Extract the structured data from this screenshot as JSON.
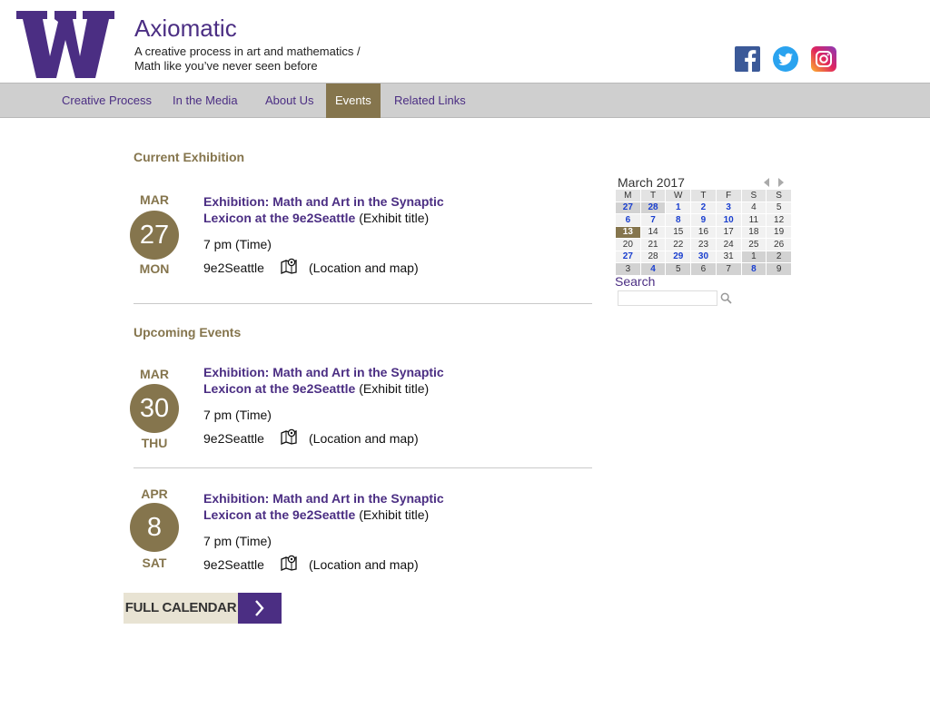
{
  "header": {
    "site_title": "Axiomatic",
    "tagline_line1": "A creative process in art and mathematics /",
    "tagline_line2": "Math like you’ve never seen before",
    "logo_icon": "uw-w-logo",
    "social": [
      "facebook-icon",
      "twitter-icon",
      "instagram-icon"
    ]
  },
  "nav": {
    "items": [
      {
        "label": "Creative Process"
      },
      {
        "label": "In the Media"
      },
      {
        "label": "About Us"
      },
      {
        "label": "Events",
        "active": true
      },
      {
        "label": "Related Links"
      }
    ]
  },
  "current": {
    "heading": "Current Exhibition",
    "event": {
      "month": "MAR",
      "day": "27",
      "dow": "MON",
      "title": "Exhibition: Math and Art in the Synaptic Lexicon at the 9e2Seattle",
      "title_note": "(Exhibit title)",
      "time": "7 pm (Time)",
      "location": "9e2Seattle",
      "location_note": "(Location and map)"
    }
  },
  "upcoming": {
    "heading": "Upcoming Events",
    "events": [
      {
        "month": "MAR",
        "day": "30",
        "dow": "THU",
        "title": "Exhibition: Math and Art in the Synaptic Lexicon at the 9e2Seattle",
        "title_note": "(Exhibit title)",
        "time": "7 pm (Time)",
        "location": "9e2Seattle",
        "location_note": "(Location and map)"
      },
      {
        "month": "APR",
        "day": "8",
        "dow": "SAT",
        "title": "Exhibition: Math and Art in the Synaptic Lexicon at the 9e2Seattle",
        "title_note": "(Exhibit title)",
        "time": "7 pm (Time)",
        "location": "9e2Seattle",
        "location_note": "(Location and map)"
      }
    ]
  },
  "full_calendar_label": "FULL CALENDAR",
  "calendar": {
    "title": "March 2017",
    "weekdays": [
      "M",
      "T",
      "W",
      "T",
      "F",
      "S",
      "S"
    ],
    "weeks": [
      [
        {
          "d": "27",
          "o": true,
          "l": true
        },
        {
          "d": "28",
          "o": true,
          "l": true
        },
        {
          "d": "1",
          "l": true
        },
        {
          "d": "2",
          "l": true
        },
        {
          "d": "3",
          "l": true
        },
        {
          "d": "4"
        },
        {
          "d": "5"
        }
      ],
      [
        {
          "d": "6",
          "l": true
        },
        {
          "d": "7",
          "l": true
        },
        {
          "d": "8",
          "l": true
        },
        {
          "d": "9",
          "l": true
        },
        {
          "d": "10",
          "l": true
        },
        {
          "d": "11"
        },
        {
          "d": "12"
        }
      ],
      [
        {
          "d": "13",
          "t": true
        },
        {
          "d": "14"
        },
        {
          "d": "15"
        },
        {
          "d": "16"
        },
        {
          "d": "17"
        },
        {
          "d": "18"
        },
        {
          "d": "19"
        }
      ],
      [
        {
          "d": "20"
        },
        {
          "d": "21"
        },
        {
          "d": "22"
        },
        {
          "d": "23"
        },
        {
          "d": "24"
        },
        {
          "d": "25"
        },
        {
          "d": "26"
        }
      ],
      [
        {
          "d": "27",
          "l": true
        },
        {
          "d": "28"
        },
        {
          "d": "29",
          "l": true
        },
        {
          "d": "30",
          "l": true
        },
        {
          "d": "31"
        },
        {
          "d": "1",
          "o": true
        },
        {
          "d": "2",
          "o": true
        }
      ],
      [
        {
          "d": "3",
          "o": true
        },
        {
          "d": "4",
          "o": true,
          "l": true
        },
        {
          "d": "5",
          "o": true
        },
        {
          "d": "6",
          "o": true
        },
        {
          "d": "7",
          "o": true
        },
        {
          "d": "8",
          "o": true,
          "l": true
        },
        {
          "d": "9",
          "o": true
        }
      ]
    ]
  },
  "search": {
    "label": "Search",
    "placeholder": ""
  },
  "colors": {
    "purple": "#4b2e83",
    "gold": "#85754d",
    "nav_bg": "#cfcfcf",
    "link_blue": "#1a3fcf"
  }
}
